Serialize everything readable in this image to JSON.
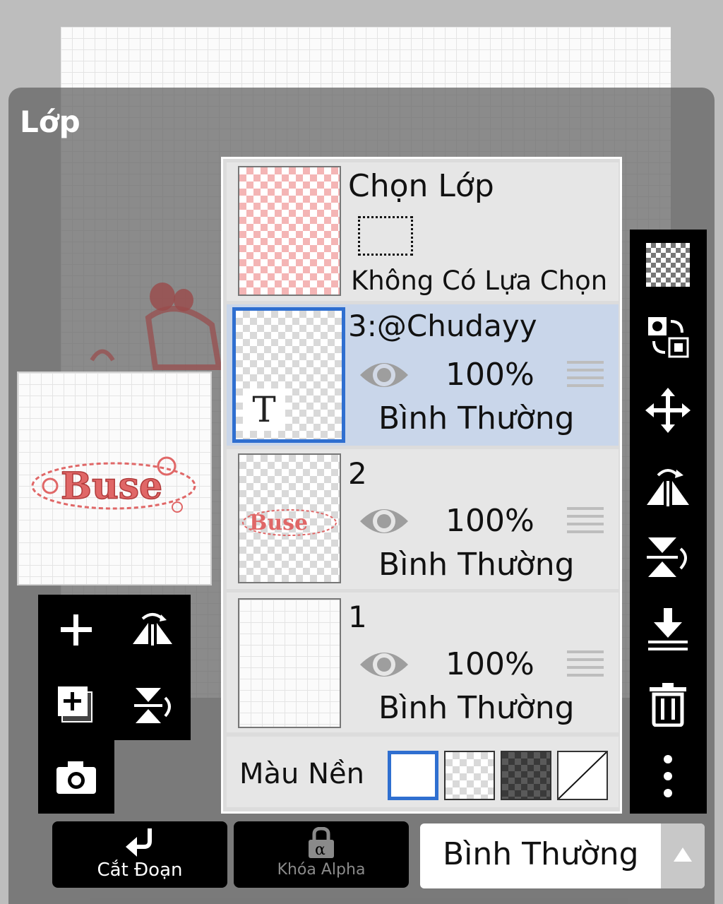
{
  "panel": {
    "title": "Lớp"
  },
  "selection": {
    "title": "Chọn Lớp",
    "status": "Không Có Lựa Chọn"
  },
  "layers": [
    {
      "name": "3:@Chudayy",
      "opacity": "100%",
      "blend": "Bình Thường",
      "selected": true,
      "type": "text"
    },
    {
      "name": "2",
      "opacity": "100%",
      "blend": "Bình Thường",
      "selected": false
    },
    {
      "name": "1",
      "opacity": "100%",
      "blend": "Bình Thường",
      "selected": false
    }
  ],
  "background": {
    "label": "Màu Nền",
    "options": [
      "white",
      "checker-light",
      "checker-dark",
      "none"
    ],
    "selected": "white"
  },
  "bottom": {
    "clip_label": "Cắt Đoạn",
    "alpha_lock_label": "Khóa Alpha",
    "blend_mode": "Bình Thường"
  },
  "canvas_art_text": "Buse",
  "text_layer_glyph": "T",
  "colors": {
    "accent": "#2f6fd0",
    "art": "#e06767",
    "selected_row": "#c9d6ea"
  }
}
